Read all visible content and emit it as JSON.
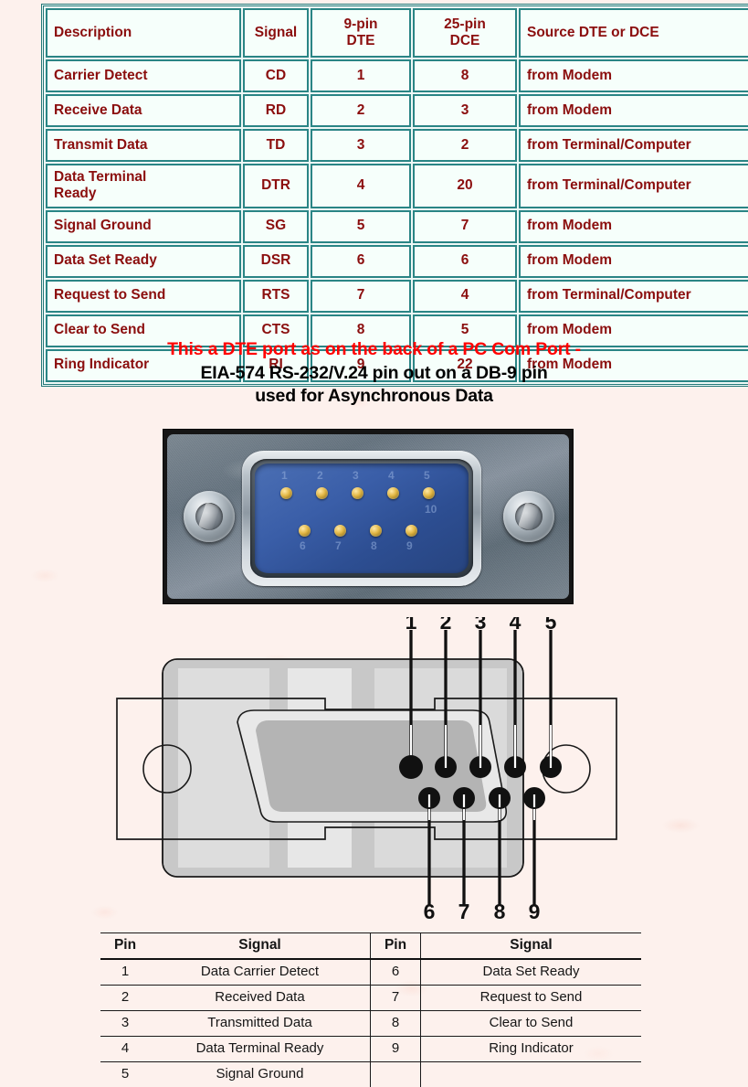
{
  "signal_table": {
    "headers": [
      "Description",
      "Signal",
      "9-pin DTE",
      "25-pin DCE",
      "Source DTE or DCE"
    ],
    "header_9pin_line1": "9-pin",
    "header_9pin_line2": "DTE",
    "header_25pin_line1": "25-pin",
    "header_25pin_line2": "DCE",
    "rows": [
      {
        "description": "Carrier Detect",
        "signal": "CD",
        "pin9": "1",
        "pin25": "8",
        "source": "from Modem"
      },
      {
        "description": "Receive Data",
        "signal": "RD",
        "pin9": "2",
        "pin25": "3",
        "source": "from Modem"
      },
      {
        "description": "Transmit Data",
        "signal": "TD",
        "pin9": "3",
        "pin25": "2",
        "source": "from Terminal/Computer"
      },
      {
        "description": "Data Terminal Ready",
        "desc_line1": "Data Terminal",
        "desc_line2": "Ready",
        "signal": "DTR",
        "pin9": "4",
        "pin25": "20",
        "source": "from   Terminal/Computer"
      },
      {
        "description": "Signal Ground",
        "signal": "SG",
        "pin9": "5",
        "pin25": "7",
        "source": "from Modem"
      },
      {
        "description": "Data Set Ready",
        "signal": "DSR",
        "pin9": "6",
        "pin25": "6",
        "source": "from Modem"
      },
      {
        "description": "Request to Send",
        "signal": "RTS",
        "pin9": "7",
        "pin25": "4",
        "source": "from   Terminal/Computer"
      },
      {
        "description": "Clear to Send",
        "signal": "CTS",
        "pin9": "8",
        "pin25": "5",
        "source": "from Modem"
      },
      {
        "description": "Ring Indicator",
        "signal": "RI",
        "pin9": "9",
        "pin25": "22",
        "source": "from Modem"
      }
    ],
    "border_color": "#2a8585",
    "text_color": "#8b0e0e",
    "cell_background": "#f6fffb"
  },
  "caption": {
    "line1": "This a DTE port as on the back of a PC Com Port -",
    "line2": "EIA-574 RS-232/V.24 pin out on a DB-9 pin",
    "line3": "used for Asynchronous Data",
    "line1_color": "#ff0000",
    "line23_color": "#000000"
  },
  "photo": {
    "alt": "Photograph of a male DB-9 DTE connector on the back of a PC",
    "insulator_color": "#3a5ea8",
    "pin_color": "#e3b846",
    "engraved_labels_top": [
      "1",
      "2",
      "3",
      "4",
      "5"
    ],
    "engraved_labels_bottom": [
      "6",
      "7",
      "8",
      "9"
    ],
    "engraved_label_extra": "10"
  },
  "diagram": {
    "alt": "Line drawing of DB-9 connector face with numbered pin callouts",
    "top_pin_numbers": [
      "1",
      "2",
      "3",
      "4",
      "5"
    ],
    "bottom_pin_numbers": [
      "6",
      "7",
      "8",
      "9"
    ],
    "shell_color": "#b8b8b8",
    "flange_outline": "#1a1a1a"
  },
  "pin_table": {
    "headers": {
      "pin": "Pin",
      "signal": "Signal"
    },
    "left_rows": [
      {
        "pin": "1",
        "signal": "Data Carrier Detect"
      },
      {
        "pin": "2",
        "signal": "Received Data"
      },
      {
        "pin": "3",
        "signal": "Transmitted Data"
      },
      {
        "pin": "4",
        "signal": "Data  Terminal Ready"
      },
      {
        "pin": "5",
        "signal": "Signal Ground"
      }
    ],
    "right_rows": [
      {
        "pin": "6",
        "signal": "Data Set Ready"
      },
      {
        "pin": "7",
        "signal": "Request to Send"
      },
      {
        "pin": "8",
        "signal": "Clear to Send"
      },
      {
        "pin": "9",
        "signal": "Ring Indicator"
      },
      {
        "pin": "",
        "signal": ""
      }
    ]
  }
}
